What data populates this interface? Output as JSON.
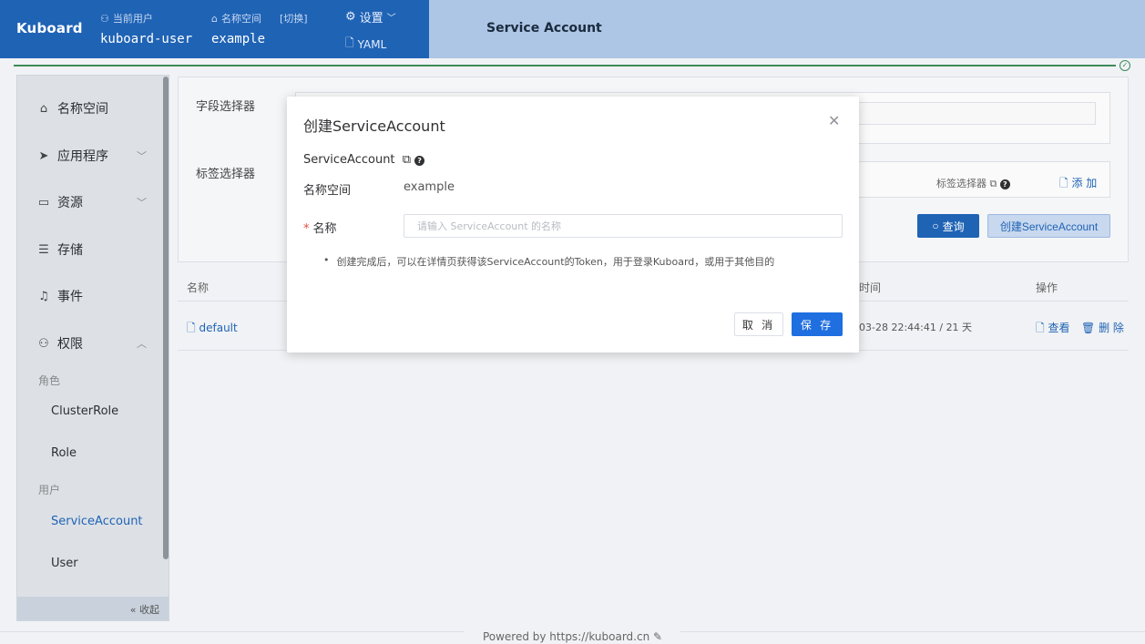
{
  "header": {
    "brand": "Kuboard",
    "current_user_label": "当前用户",
    "current_user": "kuboard-user",
    "namespace_label": "名称空间",
    "namespace_switch": "[切换]",
    "namespace": "example",
    "settings_label": "设置",
    "yaml_label": "YAML",
    "page_title": "Service Account"
  },
  "sidebar": {
    "items": [
      {
        "label": "名称空间",
        "icon": "home-icon"
      },
      {
        "label": "应用程序",
        "icon": "send-icon"
      },
      {
        "label": "资源",
        "icon": "briefcase-icon"
      },
      {
        "label": "存储",
        "icon": "database-icon"
      },
      {
        "label": "事件",
        "icon": "bell-icon"
      },
      {
        "label": "权限",
        "icon": "user-icon"
      }
    ],
    "group_role": "角色",
    "cluster_role": "ClusterRole",
    "role": "Role",
    "group_user": "用户",
    "service_account": "ServiceAccount",
    "user": "User",
    "collapse": "收起"
  },
  "filters": {
    "field_selector": "字段选择器",
    "label_selector": "标签选择器",
    "label_selector_small": "标签选择器",
    "add": "添 加",
    "query": "查询",
    "create": "创建ServiceAccount"
  },
  "table": {
    "col_name": "名称",
    "col_time": "时间",
    "col_ops": "操作",
    "row": {
      "name": "default",
      "time": "03-28 22:44:41 / 21 天",
      "view": "查看",
      "delete": "删 除"
    }
  },
  "modal": {
    "title": "创建ServiceAccount",
    "service_account_label": "ServiceAccount",
    "namespace_label": "名称空间",
    "namespace_value": "example",
    "name_label": "名称",
    "name_placeholder": "请输入 ServiceAccount 的名称",
    "name_value": "",
    "tip": "创建完成后，可以在详情页获得该ServiceAccount的Token，用于登录Kuboard，或用于其他目的",
    "cancel": "取 消",
    "save": "保 存"
  },
  "footer": {
    "text": "Powered by https://kuboard.cn"
  },
  "colors": {
    "primary": "#1f63b5",
    "save": "#1f6fe0",
    "progress": "#3d8b5a"
  }
}
